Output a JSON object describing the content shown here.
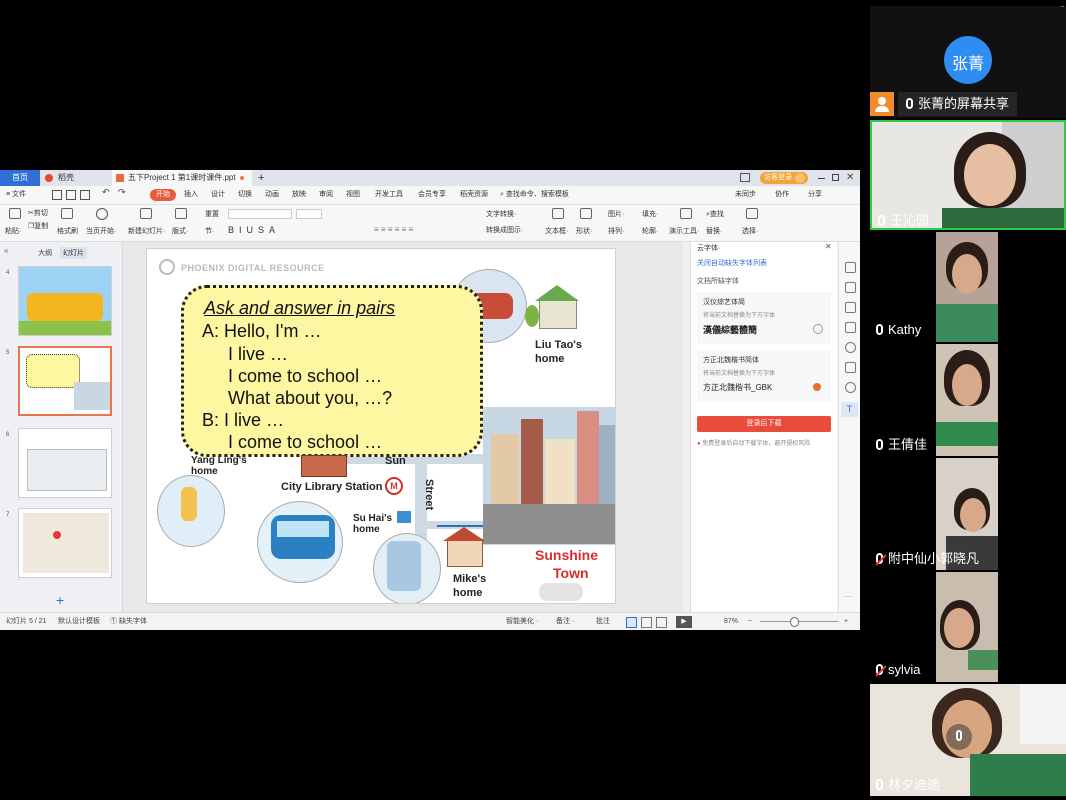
{
  "wps": {
    "tabs": {
      "home": "首页",
      "daoke": "稻壳",
      "doc": "五下Project 1 第1课时课件.ppt",
      "add": "+"
    },
    "login_pill": "访客登录",
    "menu": {
      "file": "≡ 文件",
      "items": [
        "开始",
        "插入",
        "设计",
        "切换",
        "动画",
        "放映",
        "审阅",
        "视图",
        "开发工具",
        "会员专享",
        "稻壳资源"
      ],
      "search": "查找命令、搜索模板",
      "right": [
        "未同步",
        "协作",
        "分享"
      ]
    },
    "ribbon": {
      "paste": "粘贴·",
      "cut": "剪切",
      "copy": "复制",
      "format_painter": "格式刷",
      "play_from_current": "当页开始·",
      "new_slide": "新建幻灯片·",
      "layout": "版式·",
      "reset": "重置",
      "section": "节·",
      "textbox": "文本框·",
      "shape": "形状·",
      "arrange": "排列·",
      "outline": "轮廓·",
      "find": "查找",
      "replace": "替换·",
      "select": "选择·",
      "show_tools": "演示工具·",
      "picture": "图片·",
      "fill": "填充·",
      "textart": "转换成图示·",
      "to_text": "文字转换·"
    },
    "thumbs": {
      "tab_outline": "大纲",
      "tab_slides": "幻灯片",
      "nums": [
        "4",
        "5",
        "6",
        "7"
      ],
      "add": "+"
    },
    "slide": {
      "brand": "PHOENIX DIGITAL RESOURCE",
      "title": "Ask and answer in pairs",
      "lines": [
        "A: Hello, I'm …",
        "I live …",
        "I come to school …",
        "What about you, …?",
        "B: I live …",
        "I come to school …"
      ],
      "labels": {
        "liutao": "Liu Tao's",
        "liutao2": "home",
        "yangling": "Yang Ling's",
        "yangling2": "home",
        "sun": "Sun",
        "street": "Street",
        "library": "City Library Station",
        "metro": "M",
        "suhai": "Su Hai's",
        "suhai2": "home",
        "mike": "Mike's",
        "mike2": "home",
        "sunshine": "Sunshine",
        "town": "Town"
      }
    },
    "fontpanel": {
      "title": "云字体·",
      "link": "关闭自动缺失字体列表",
      "doc_fonts": "文档所缺字体",
      "section1": "汉仪综艺体简",
      "sub1": "将当前文档替换为下方字体",
      "font1": "漢儀綜藝體簡",
      "section2": "方正北魏楷书简体",
      "sub2": "将当前文档替换为下方字体",
      "font2": "方正北魏楷书_GBK",
      "button": "登录后下载",
      "note": "免费登录后自动下载字体，避开侵权风险"
    },
    "status": {
      "slide": "幻灯片 5 / 21",
      "template": "默认设计模板",
      "missing_font": "缺失字体",
      "beautify": "智能美化 ·",
      "notes": "备注 ·",
      "comments": "批注",
      "zoom": "87%",
      "minus": "−",
      "plus": "+"
    }
  },
  "meeting": {
    "host": {
      "avatar_text": "张菁",
      "name": "张菁的屏幕共享"
    },
    "participants": [
      {
        "name": "王沁园",
        "muted": false
      },
      {
        "name": "Kathy",
        "muted": false
      },
      {
        "name": "王倩佳",
        "muted": false
      },
      {
        "name": "附中仙小郭晓凡",
        "muted": true
      },
      {
        "name": "sylvia",
        "muted": true
      },
      {
        "name": "林夕迪迪",
        "muted": false
      }
    ]
  }
}
